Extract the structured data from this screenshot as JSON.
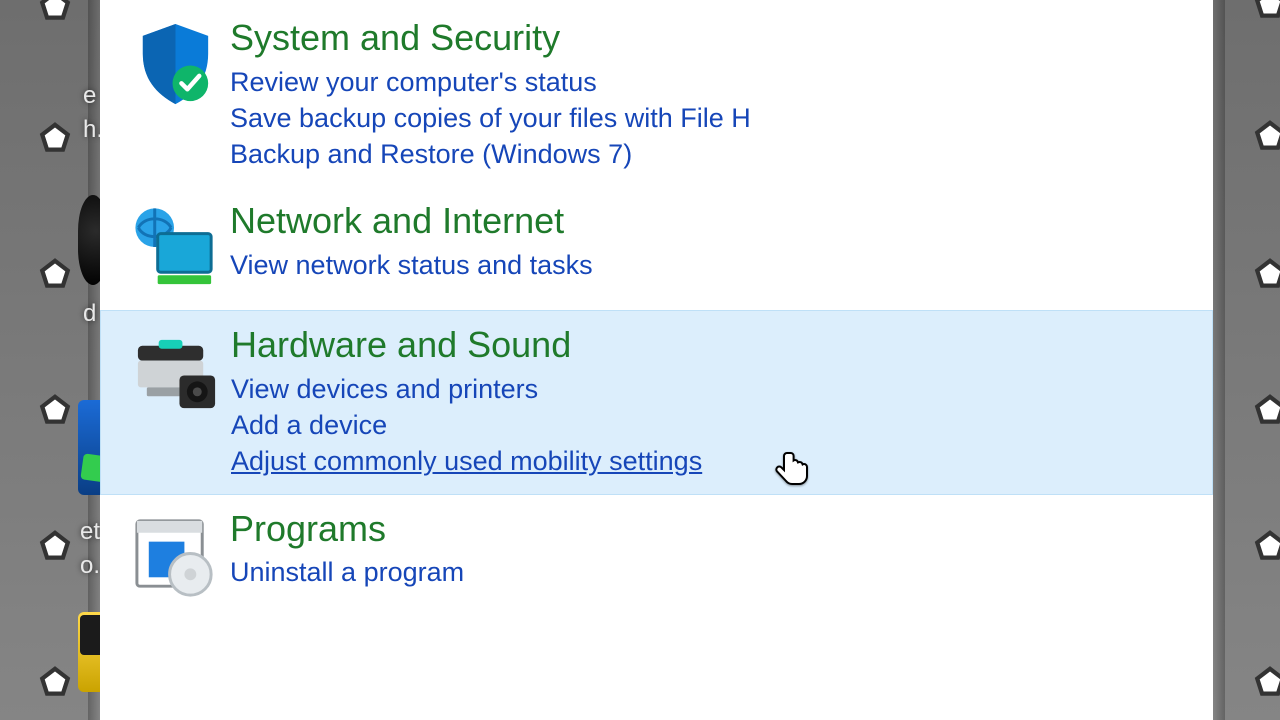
{
  "categories": [
    {
      "id": "system-security",
      "title": "System and Security",
      "links": [
        "Review your computer's status",
        "Save backup copies of your files with File H",
        "Backup and Restore (Windows 7)"
      ]
    },
    {
      "id": "network-internet",
      "title": "Network and Internet",
      "links": [
        "View network status and tasks"
      ]
    },
    {
      "id": "hardware-sound",
      "title": "Hardware and Sound",
      "hovered": true,
      "links": [
        "View devices and printers",
        "Add a device",
        "Adjust commonly used mobility settings"
      ],
      "hovered_link_index": 2
    },
    {
      "id": "programs",
      "title": "Programs",
      "links": [
        "Uninstall a program"
      ]
    }
  ],
  "desktop_fragments": {
    "l1": "e",
    "l2": "h.",
    "l3": "d",
    "l4": "et",
    "l5": "o."
  },
  "colors": {
    "heading": "#1f7a2b",
    "link": "#1646b8",
    "hover_bg": "#dceefc",
    "hover_border": "#bfe0f7"
  }
}
